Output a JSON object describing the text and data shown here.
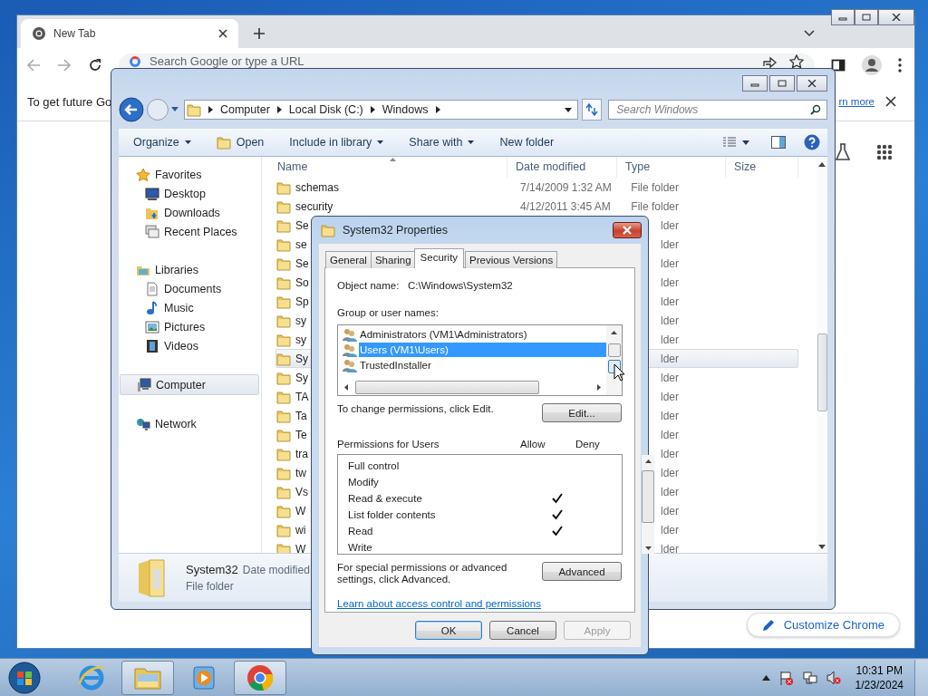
{
  "browser": {
    "tab": {
      "title": "New Tab",
      "selected": true
    },
    "omnibox": {
      "placeholder": "Search Google or type a URL"
    },
    "infobar": {
      "text": "To get future Go",
      "link": "rn more"
    },
    "customize_button": "Customize Chrome"
  },
  "explorer": {
    "breadcrumbs": [
      "Computer",
      "Local Disk (C:)",
      "Windows"
    ],
    "search": {
      "placeholder": "Search Windows"
    },
    "commands": [
      {
        "label": "Organize",
        "dropdown": true,
        "icon": false
      },
      {
        "label": "Open",
        "dropdown": false,
        "icon": true
      },
      {
        "label": "Include in library",
        "dropdown": true,
        "icon": false
      },
      {
        "label": "Share with",
        "dropdown": true,
        "icon": false
      },
      {
        "label": "New folder",
        "dropdown": false,
        "icon": false
      }
    ],
    "nav": [
      {
        "label": "Favorites",
        "kind": "favorites",
        "selected": false,
        "children": [
          {
            "label": "Desktop",
            "kind": "desktop",
            "selected": false
          },
          {
            "label": "Downloads",
            "kind": "downloads",
            "selected": false
          },
          {
            "label": "Recent Places",
            "kind": "recent",
            "selected": false
          }
        ]
      },
      {
        "label": "Libraries",
        "kind": "libraries",
        "selected": false,
        "children": [
          {
            "label": "Documents",
            "kind": "documents",
            "selected": false
          },
          {
            "label": "Music",
            "kind": "music",
            "selected": false
          },
          {
            "label": "Pictures",
            "kind": "pictures",
            "selected": false
          },
          {
            "label": "Videos",
            "kind": "videos",
            "selected": false
          }
        ]
      },
      {
        "label": "Computer",
        "kind": "computer",
        "selected": true
      },
      {
        "label": "Network",
        "kind": "network",
        "selected": false
      }
    ],
    "columns": [
      "Name",
      "Date modified",
      "Type",
      "Size"
    ],
    "rows": [
      {
        "name": "schemas",
        "date": "7/14/2009 1:32 AM",
        "type": "File folder",
        "selected": false
      },
      {
        "name": "security",
        "date": "4/12/2011 3:45 AM",
        "type": "File folder",
        "selected": false
      },
      {
        "name": "Se",
        "type": "lder",
        "selected": false
      },
      {
        "name": "se",
        "type": "lder",
        "selected": false
      },
      {
        "name": "Se",
        "type": "lder",
        "selected": false
      },
      {
        "name": "So",
        "type": "lder",
        "selected": false
      },
      {
        "name": "Sp",
        "type": "lder",
        "selected": false
      },
      {
        "name": "sy",
        "type": "lder",
        "selected": false
      },
      {
        "name": "sy",
        "type": "lder",
        "selected": false
      },
      {
        "name": "Sy",
        "type": "lder",
        "selected": true
      },
      {
        "name": "Sy",
        "type": "lder",
        "selected": false
      },
      {
        "name": "TA",
        "type": "lder",
        "selected": false
      },
      {
        "name": "Ta",
        "type": "lder",
        "selected": false
      },
      {
        "name": "Te",
        "type": "lder",
        "selected": false
      },
      {
        "name": "tra",
        "type": "lder",
        "selected": false
      },
      {
        "name": "tw",
        "type": "lder",
        "selected": false
      },
      {
        "name": "Vs",
        "type": "lder",
        "selected": false
      },
      {
        "name": "W",
        "type": "lder",
        "selected": false
      },
      {
        "name": "wi",
        "type": "lder",
        "selected": false
      },
      {
        "name": "W",
        "type": "lder",
        "selected": false
      }
    ],
    "details": {
      "name": "System32",
      "meta": "Date modified",
      "type": "File folder"
    }
  },
  "dialog": {
    "title": "System32 Properties",
    "tabs": [
      {
        "label": "General",
        "selected": false
      },
      {
        "label": "Sharing",
        "selected": false
      },
      {
        "label": "Security",
        "selected": true
      },
      {
        "label": "Previous Versions",
        "selected": false
      }
    ],
    "object_label": "Object name:",
    "object_value": "C:\\Windows\\System32",
    "group_label": "Group or user names:",
    "users": [
      {
        "name": "Administrators (VM1\\Administrators)",
        "selected": false
      },
      {
        "name": "Users (VM1\\Users)",
        "selected": true
      },
      {
        "name": "TrustedInstaller",
        "selected": false
      }
    ],
    "change_text": "To change permissions, click Edit.",
    "edit_button": "Edit...",
    "permissions_label": "Permissions for Users",
    "allow_label": "Allow",
    "deny_label": "Deny",
    "permissions": [
      {
        "name": "Full control",
        "allow": false,
        "deny": false
      },
      {
        "name": "Modify",
        "allow": false,
        "deny": false
      },
      {
        "name": "Read & execute",
        "allow": true,
        "deny": false
      },
      {
        "name": "List folder contents",
        "allow": true,
        "deny": false
      },
      {
        "name": "Read",
        "allow": true,
        "deny": false
      },
      {
        "name": "Write",
        "allow": false,
        "deny": false
      }
    ],
    "special_text": "For special permissions or advanced settings, click Advanced.",
    "advanced_button": "Advanced",
    "link": "Learn about access control and permissions",
    "buttons": [
      {
        "label": "OK",
        "default": true,
        "disabled": false
      },
      {
        "label": "Cancel",
        "default": false,
        "disabled": false
      },
      {
        "label": "Apply",
        "default": false,
        "disabled": true
      }
    ]
  },
  "taskbar": {
    "apps": [
      {
        "kind": "ie",
        "active": false
      },
      {
        "kind": "explorer",
        "active": true
      },
      {
        "kind": "media",
        "active": false
      },
      {
        "kind": "chrome",
        "active": true
      }
    ],
    "time": "10:31 PM",
    "date": "1/23/2024"
  }
}
